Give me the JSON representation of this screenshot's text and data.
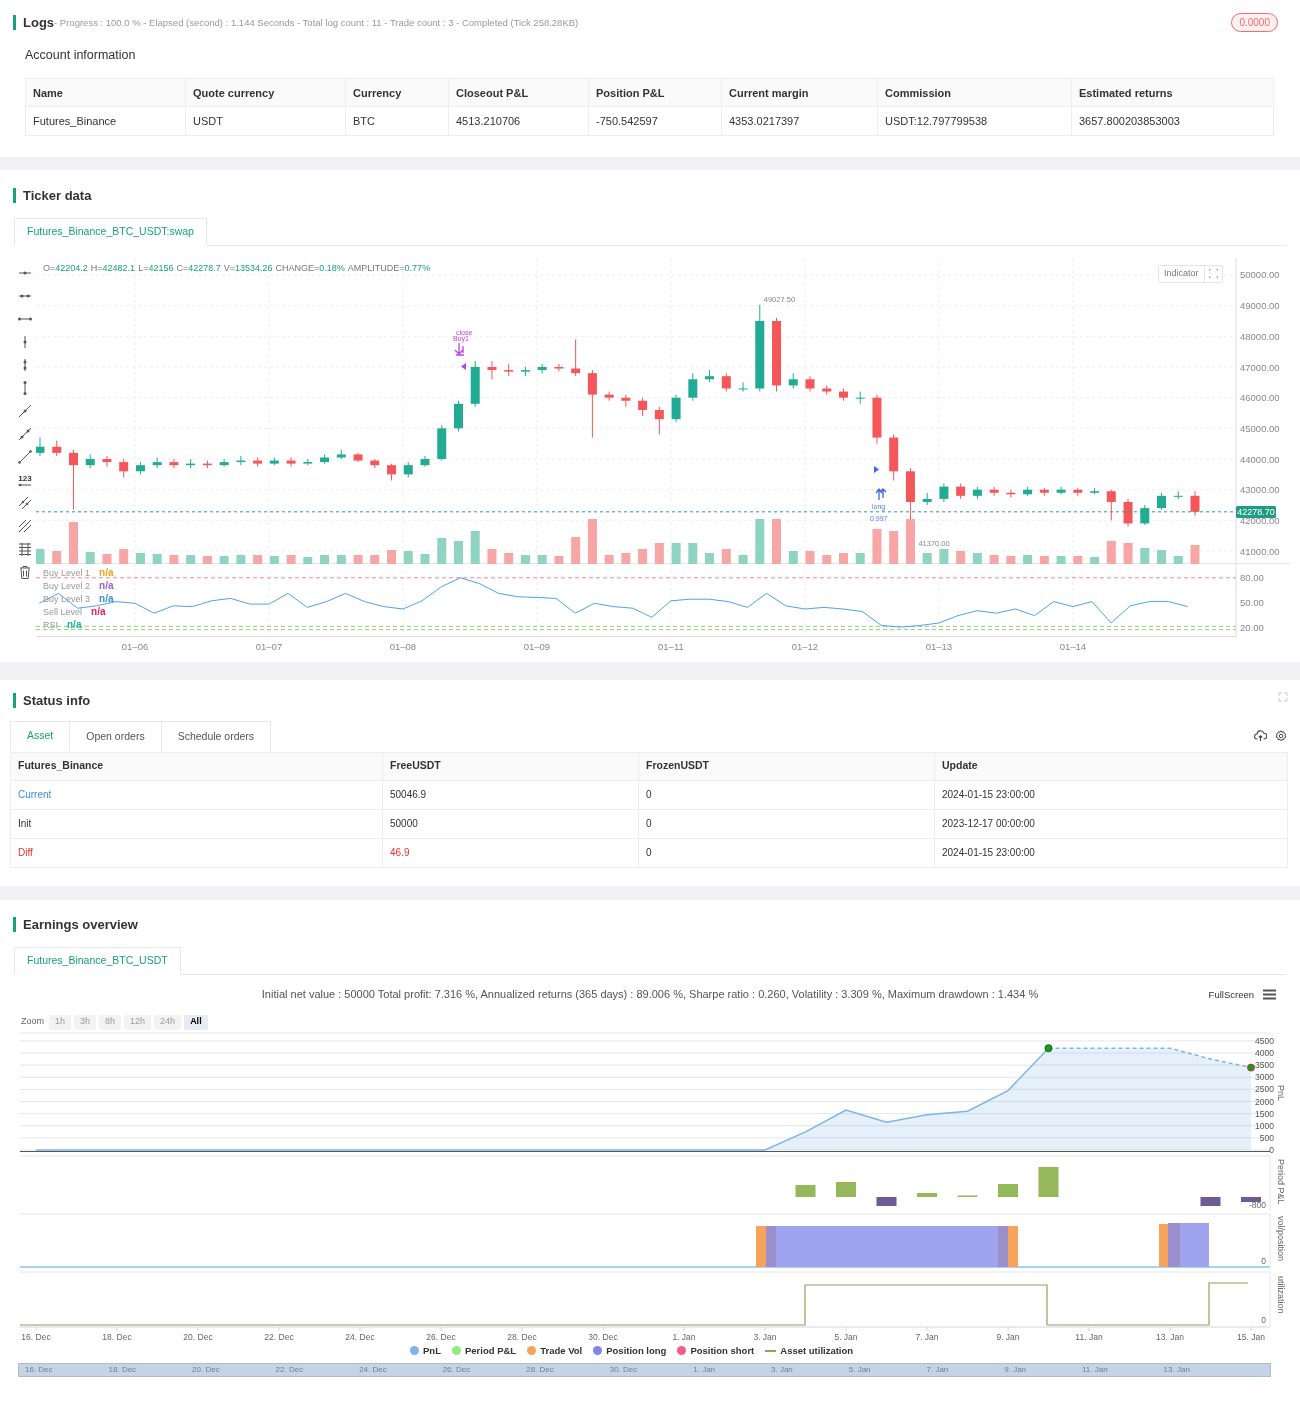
{
  "logs": {
    "title": "Logs",
    "summary": "- Progress : 100.0 % - Elapsed (second) : 1.144  Seconds - Total log count : 11 - Trade count : 3 - Completed (Tick 258.28KB)",
    "badge": "0.0000"
  },
  "account": {
    "title": "Account information",
    "columns": [
      "Name",
      "Quote currency",
      "Currency",
      "Closeout P&L",
      "Position P&L",
      "Current margin",
      "Commission",
      "Estimated returns"
    ],
    "rows": [
      [
        "Futures_Binance",
        "USDT",
        "BTC",
        "4513.210706",
        "-750.542597",
        "4353.0217397",
        "USDT:12.797799538",
        "3657.800203853003"
      ]
    ]
  },
  "ticker": {
    "title": "Ticker data",
    "tabs": [
      {
        "label": "Futures_Binance_BTC_USDT:swap",
        "selected": true
      }
    ],
    "ohlc": [
      {
        "label": "O=",
        "value": "42204.2"
      },
      {
        "label": "H=",
        "value": "42482.1"
      },
      {
        "label": "L=",
        "value": "42156"
      },
      {
        "label": "C=",
        "value": "42278.7"
      },
      {
        "label": "V=",
        "value": "13534.26"
      },
      {
        "label": "CHANGE=",
        "value": "0.18%"
      },
      {
        "label": "AMPLITUDE=",
        "value": "0.77%"
      }
    ],
    "indicator_button": "Indicator",
    "toolbar_label": "123",
    "current_price": "42278.70",
    "legend": [
      {
        "label": "Buy Level 1",
        "value": "n/a",
        "color": "#f7a21b"
      },
      {
        "label": "Buy Level 2",
        "value": "n/a",
        "color": "#9c5bd6"
      },
      {
        "label": "Buy Level 3",
        "value": "n/a",
        "color": "#3c8fe0"
      },
      {
        "label": "Sell Level",
        "value": "n/a",
        "color": "#e91e63"
      },
      {
        "value": "n/a",
        "color": "#1fb3a3"
      }
    ],
    "price_panel": {
      "chart_data": {
        "type": "candlestick",
        "grid": true,
        "ylim": [
          40610,
          50554
        ],
        "ref_lines": [
          {
            "axis": "y",
            "value": 42278.7,
            "color": "#2a9d8f"
          }
        ],
        "categories": [
          null,
          null,
          null,
          null,
          null,
          null,
          null,
          null,
          null,
          null,
          null,
          null,
          null,
          null,
          null,
          null,
          null,
          null,
          null,
          null,
          null,
          null,
          null,
          null,
          null,
          null,
          null,
          null,
          null,
          null,
          null,
          null,
          null,
          null,
          null,
          null,
          null,
          null,
          null,
          null,
          null,
          null,
          null,
          null,
          null,
          null,
          null,
          null,
          null,
          null,
          null,
          null,
          null,
          null,
          null,
          null,
          null,
          null,
          null,
          null,
          null,
          null,
          null,
          null,
          null,
          null,
          null,
          null,
          null,
          null
        ],
        "ohlc": [
          [
            44200,
            44700,
            44100,
            44400
          ],
          [
            44400,
            44600,
            44100,
            44200
          ],
          [
            44200,
            44300,
            42350,
            43800
          ],
          [
            43800,
            44150,
            43700,
            44000
          ],
          [
            44000,
            44100,
            43750,
            43900
          ],
          [
            43900,
            44000,
            43400,
            43600
          ],
          [
            43600,
            43900,
            43500,
            43800
          ],
          [
            43800,
            44050,
            43700,
            43900
          ],
          [
            43900,
            44000,
            43700,
            43800
          ],
          [
            43800,
            44000,
            43700,
            43850
          ],
          [
            43850,
            43950,
            43700,
            43800
          ],
          [
            43800,
            44000,
            43750,
            43900
          ],
          [
            43900,
            44100,
            43800,
            43950
          ],
          [
            43950,
            44050,
            43750,
            43850
          ],
          [
            43850,
            44050,
            43800,
            43950
          ],
          [
            43950,
            44050,
            43750,
            43850
          ],
          [
            43850,
            44000,
            43800,
            43900
          ],
          [
            43900,
            44150,
            43850,
            44050
          ],
          [
            44050,
            44300,
            44000,
            44150
          ],
          [
            44150,
            44200,
            43900,
            43950
          ],
          [
            43950,
            44000,
            43700,
            43800
          ],
          [
            43800,
            43850,
            43300,
            43500
          ],
          [
            43500,
            43900,
            43400,
            43800
          ],
          [
            43800,
            44100,
            43750,
            44000
          ],
          [
            44000,
            45100,
            43950,
            45000
          ],
          [
            45000,
            45900,
            44900,
            45800
          ],
          [
            45800,
            47200,
            45700,
            47000
          ],
          [
            47000,
            47200,
            46600,
            46900
          ],
          [
            46900,
            47100,
            46700,
            46850
          ],
          [
            46850,
            47000,
            46700,
            46900
          ],
          [
            46900,
            47100,
            46800,
            47000
          ],
          [
            47000,
            47100,
            46850,
            46950
          ],
          [
            46950,
            47900,
            46700,
            46800
          ],
          [
            46800,
            46900,
            44700,
            46100
          ],
          [
            46100,
            46200,
            45900,
            46000
          ],
          [
            46000,
            46100,
            45700,
            45900
          ],
          [
            45900,
            46000,
            45400,
            45600
          ],
          [
            45600,
            45700,
            44800,
            45300
          ],
          [
            45300,
            46100,
            45200,
            46000
          ],
          [
            46000,
            46800,
            45900,
            46600
          ],
          [
            46600,
            46900,
            46500,
            46700
          ],
          [
            46700,
            46800,
            46200,
            46300
          ],
          [
            46300,
            46500,
            46200,
            46300
          ],
          [
            46300,
            49027.5,
            46200,
            48500
          ],
          [
            48500,
            48600,
            46200,
            46400
          ],
          [
            46400,
            46800,
            46300,
            46600
          ],
          [
            46600,
            46700,
            46200,
            46300
          ],
          [
            46300,
            46400,
            46100,
            46200
          ],
          [
            46200,
            46300,
            45900,
            46000
          ],
          [
            46000,
            46200,
            45800,
            46000
          ],
          [
            46000,
            46100,
            44500,
            44700
          ],
          [
            44700,
            44800,
            43300,
            43600
          ],
          [
            43600,
            43700,
            41370,
            42600
          ],
          [
            42600,
            42900,
            42500,
            42700
          ],
          [
            42700,
            43200,
            42600,
            43100
          ],
          [
            43100,
            43200,
            42700,
            42800
          ],
          [
            42800,
            43100,
            42700,
            43000
          ],
          [
            43000,
            43100,
            42800,
            42900
          ],
          [
            42900,
            43000,
            42750,
            42850
          ],
          [
            42850,
            43100,
            42800,
            43000
          ],
          [
            43000,
            43050,
            42800,
            42900
          ],
          [
            42900,
            43100,
            42850,
            43000
          ],
          [
            43000,
            43050,
            42800,
            42900
          ],
          [
            42900,
            43050,
            42850,
            42950
          ],
          [
            42950,
            43000,
            42000,
            42600
          ],
          [
            42600,
            42700,
            41800,
            41900
          ],
          [
            41900,
            42500,
            41850,
            42400
          ],
          [
            42400,
            42900,
            42350,
            42800
          ],
          [
            42800,
            42950,
            42700,
            42800
          ],
          [
            42800,
            42950,
            42150,
            42280
          ]
        ],
        "yticks": [
          {
            "value": 50000,
            "label": "50000.00"
          },
          {
            "value": 49000,
            "label": "49000.00"
          },
          {
            "value": 48000,
            "label": "48000.00"
          },
          {
            "value": 47000,
            "label": "47000.00"
          },
          {
            "value": 46000,
            "label": "46000.00"
          },
          {
            "value": 45000,
            "label": "45000.00"
          },
          {
            "value": 44000,
            "label": "44000.00"
          },
          {
            "value": 43000,
            "label": "43000.00"
          },
          {
            "value": 42000,
            "label": "42000.00"
          },
          {
            "value": 41000,
            "label": "41000.00"
          }
        ]
      }
    },
    "rsi_panel": {
      "chart_data": {
        "type": "line",
        "grid": true,
        "ylim": [
          9.2,
          96.8
        ],
        "ref_lines": [
          {
            "axis": "y",
            "value": 80,
            "color": "#f28b8b"
          },
          {
            "axis": "y",
            "value": 21,
            "color": "#8fd46f"
          },
          {
            "axis": "y",
            "value": 17,
            "color": "#8fd46f"
          }
        ],
        "categories": [
          null,
          null,
          null,
          null,
          null,
          "01–06",
          null,
          null,
          null,
          null,
          null,
          null,
          "01–07",
          null,
          null,
          null,
          null,
          null,
          null,
          "01–08",
          null,
          null,
          null,
          null,
          null,
          null,
          "01–09",
          null,
          null,
          null,
          null,
          null,
          null,
          "01–11",
          null,
          null,
          null,
          null,
          null,
          null,
          "01–12",
          null,
          null,
          null,
          null,
          null,
          null,
          "01–13",
          null,
          null,
          null,
          null,
          null,
          null,
          "01–14",
          null,
          null,
          null,
          null,
          null,
          null
        ],
        "series": [
          {
            "name": "RSI",
            "color": "#4da3f0",
            "values": [
              49,
              61,
              43,
              46,
              51,
              49,
              37,
              46,
              45,
              52,
              55,
              48,
              48,
              61,
              44,
              51,
              61,
              51,
              45,
              42,
              52,
              69,
              80,
              73,
              61,
              57,
              56,
              55,
              37,
              49,
              45,
              43,
              32,
              52,
              54,
              54,
              51,
              44,
              61,
              46,
              42,
              44,
              42,
              39,
              22,
              20,
              22,
              25,
              34,
              40,
              37,
              42,
              34,
              51,
              45,
              51,
              25,
              46,
              51,
              51,
              45
            ]
          }
        ],
        "yticks": [
          {
            "value": 80,
            "label": "80.00"
          },
          {
            "value": 50,
            "label": "50.00"
          },
          {
            "value": 20,
            "label": "20.00"
          }
        ]
      }
    },
    "high_label": "49027.50",
    "low_label": "41370.00",
    "top_marker": [
      "close",
      "Buy1"
    ],
    "bottom_marker": [
      "long",
      "0.997"
    ]
  },
  "status": {
    "title": "Status info",
    "tabs": [
      {
        "label": "Asset",
        "selected": true
      },
      {
        "label": "Open orders",
        "selected": false
      },
      {
        "label": "Schedule orders",
        "selected": false
      }
    ],
    "columns": [
      "Futures_Binance",
      "FreeUSDT",
      "FrozenUSDT",
      "Update"
    ],
    "rows": [
      {
        "kind": "current",
        "cells": [
          "Current",
          "50046.9",
          "0",
          "2024-01-15 23:00:00"
        ]
      },
      {
        "kind": "init",
        "cells": [
          "Init",
          "50000",
          "0",
          "2023-12-17 00:00:00"
        ]
      },
      {
        "kind": "diff",
        "cells": [
          "Diff",
          "46.9",
          "0",
          "2024-01-15 23:00:00"
        ]
      }
    ]
  },
  "earnings": {
    "title": "Earnings overview",
    "tabs": [
      {
        "label": "Futures_Binance_BTC_USDT",
        "selected": true
      }
    ],
    "summary": "Initial net value : 50000 Total profit: 7.316 %, Annualized returns (365 days) : 89.006 %, Sharpe ratio : 0.260, Volatility : 3.309 %, Maximum drawdown : 1.434 %",
    "fullscreen": "FullScreen",
    "zoom_label": "Zoom",
    "zoom_options": [
      {
        "label": "1h",
        "selected": false,
        "disabled": true
      },
      {
        "label": "3h",
        "selected": false,
        "disabled": true
      },
      {
        "label": "8h",
        "selected": false,
        "disabled": true
      },
      {
        "label": "12h",
        "selected": false,
        "disabled": true
      },
      {
        "label": "24h",
        "selected": false,
        "disabled": true
      },
      {
        "label": "All",
        "selected": true,
        "disabled": false
      }
    ],
    "chart_data": {
      "type": "area",
      "grid": true,
      "ylabel": "PnL",
      "ylim": [
        -62,
        4826
      ],
      "categories": [
        null,
        null,
        null,
        null,
        null,
        null,
        null,
        null,
        null,
        null,
        null,
        null,
        null,
        null,
        null,
        null,
        null,
        null,
        null,
        null,
        null,
        null,
        null,
        null,
        null,
        null,
        null,
        null,
        null,
        null,
        null
      ],
      "series": [
        {
          "name": "PnL",
          "color": "#7cb5ec",
          "values": [
            0,
            0,
            0,
            0,
            0,
            0,
            0,
            0,
            0,
            0,
            0,
            0,
            0,
            0,
            0,
            0,
            0,
            0,
            0,
            750,
            1650,
            1150,
            1450,
            1600,
            2450,
            4200,
            4200,
            4200,
            4200,
            3750,
            3400
          ]
        }
      ],
      "yticks": [
        {
          "value": 0,
          "label": "0"
        },
        {
          "value": 500,
          "label": "500"
        },
        {
          "value": 1000,
          "label": "1000"
        },
        {
          "value": 1500,
          "label": "1500"
        },
        {
          "value": 2000,
          "label": "2000"
        },
        {
          "value": 2500,
          "label": "2500"
        },
        {
          "value": 3000,
          "label": "3000"
        },
        {
          "value": 3500,
          "label": "3500"
        },
        {
          "value": 4000,
          "label": "4000"
        },
        {
          "value": 4500,
          "label": "4500"
        }
      ]
    },
    "panels": [
      {
        "title": "Period P&L",
        "tick": "-800"
      },
      {
        "title": "vol/position",
        "tick": "0"
      },
      {
        "title": "utilization",
        "tick": "0"
      }
    ],
    "date_axis": [
      "16. Dec",
      "18. Dec",
      "20. Dec",
      "22. Dec",
      "24. Dec",
      "26. Dec",
      "28. Dec",
      "30. Dec",
      "1. Jan",
      "3. Jan",
      "5. Jan",
      "7. Jan",
      "9. Jan",
      "11. Jan",
      "13. Jan",
      "15. Jan"
    ],
    "legend": [
      {
        "label": "Period P&L",
        "kind": "dot",
        "color": "#90ed7d"
      },
      {
        "label": "Trade Vol",
        "kind": "dot",
        "color": "#f7a35c"
      },
      {
        "label": "Position long",
        "kind": "dot",
        "color": "#8085e9"
      },
      {
        "label": "Position short",
        "kind": "dot",
        "color": "#f15c80"
      },
      {
        "label": "Asset utilization",
        "kind": "line",
        "color": "#a09a5c"
      }
    ],
    "navigator_dates": [
      "16. Dec",
      "18. Dec",
      "20. Dec",
      "22. Dec",
      "24. Dec",
      "26. Dec",
      "28. Dec",
      "30. Dec",
      "1. Jan",
      "3. Jan",
      "5. Jan",
      "7. Jan",
      "9. Jan",
      "11. Jan",
      "13. Jan"
    ]
  }
}
